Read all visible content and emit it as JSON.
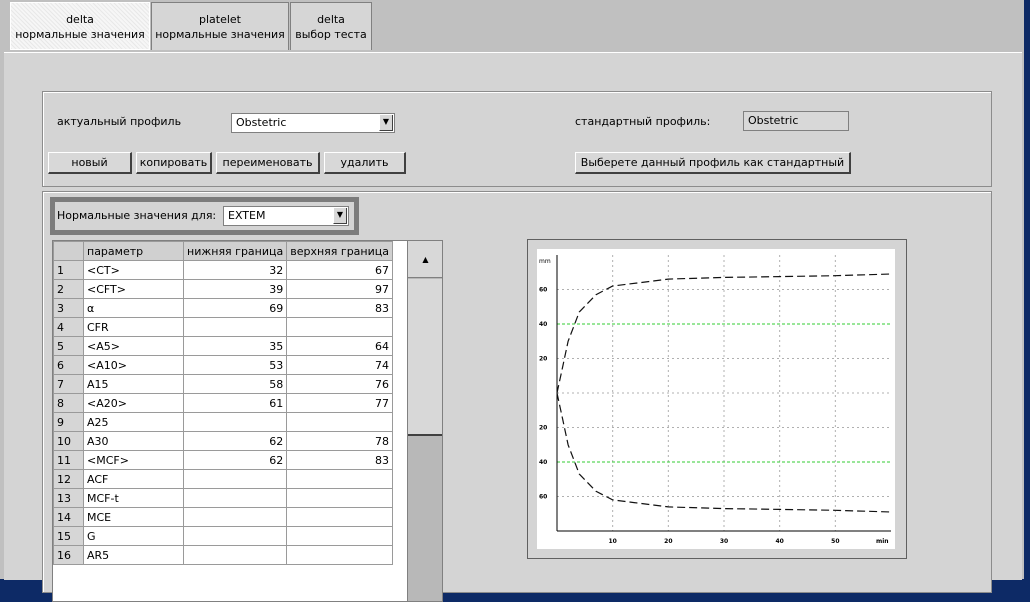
{
  "tabs": [
    {
      "line1": "delta",
      "line2": "нормальные значения"
    },
    {
      "line1": "platelet",
      "line2": "нормальные значения"
    },
    {
      "line1": "delta",
      "line2": "выбор теста"
    }
  ],
  "profile": {
    "actual_label": "актуальный профиль",
    "actual_value": "Obstetric",
    "standard_label": "стандартный профиль:",
    "standard_value": "Obstetric",
    "buttons": {
      "new": "новый",
      "copy": "копировать",
      "rename": "переименовать",
      "delete": "удалить",
      "set_standard": "Выберете данный профиль как стандартный"
    }
  },
  "normal_values": {
    "label": "Нормальные значения для:",
    "selected": "EXTEM"
  },
  "table": {
    "columns": [
      "параметр",
      "нижняя граница",
      "верхняя граница"
    ],
    "rows": [
      {
        "n": "1",
        "param": "<CT>",
        "low": "32",
        "high": "67"
      },
      {
        "n": "2",
        "param": "<CFT>",
        "low": "39",
        "high": "97"
      },
      {
        "n": "3",
        "param": "α",
        "low": "69",
        "high": "83"
      },
      {
        "n": "4",
        "param": "CFR",
        "low": "",
        "high": ""
      },
      {
        "n": "5",
        "param": "<A5>",
        "low": "35",
        "high": "64"
      },
      {
        "n": "6",
        "param": "<A10>",
        "low": "53",
        "high": "74"
      },
      {
        "n": "7",
        "param": "A15",
        "low": "58",
        "high": "76"
      },
      {
        "n": "8",
        "param": "<A20>",
        "low": "61",
        "high": "77"
      },
      {
        "n": "9",
        "param": "A25",
        "low": "",
        "high": ""
      },
      {
        "n": "10",
        "param": "A30",
        "low": "62",
        "high": "78"
      },
      {
        "n": "11",
        "param": "<MCF>",
        "low": "62",
        "high": "83"
      },
      {
        "n": "12",
        "param": "ACF",
        "low": "",
        "high": ""
      },
      {
        "n": "13",
        "param": "MCF-t",
        "low": "",
        "high": ""
      },
      {
        "n": "14",
        "param": "MCE",
        "low": "",
        "high": ""
      },
      {
        "n": "15",
        "param": "G",
        "low": "",
        "high": ""
      },
      {
        "n": "16",
        "param": "AR5",
        "low": "",
        "high": ""
      }
    ]
  },
  "chart_data": {
    "type": "line",
    "ylabel": "mm",
    "xlabel": "min",
    "x_ticks": [
      "10",
      "20",
      "30",
      "40",
      "50"
    ],
    "y_ticks_upper": [
      "60",
      "40",
      "20"
    ],
    "y_ticks_lower": [
      "20",
      "40",
      "60"
    ],
    "xlim": [
      0,
      60
    ],
    "ylim": [
      -80,
      80
    ],
    "grid": true,
    "highlight_lines_mm": [
      40,
      -40
    ],
    "highlight_color": "#33cc33",
    "series": [
      {
        "values": [
          [
            0,
            0
          ],
          [
            1,
            15
          ],
          [
            2,
            30
          ],
          [
            4,
            47
          ],
          [
            7,
            57
          ],
          [
            10,
            62
          ],
          [
            15,
            64
          ],
          [
            20,
            66
          ],
          [
            30,
            67
          ],
          [
            40,
            67.5
          ],
          [
            50,
            68
          ],
          [
            60,
            69
          ]
        ]
      },
      {
        "values": [
          [
            0,
            0
          ],
          [
            1,
            -15
          ],
          [
            2,
            -30
          ],
          [
            4,
            -47
          ],
          [
            7,
            -57
          ],
          [
            10,
            -62
          ],
          [
            15,
            -64
          ],
          [
            20,
            -66
          ],
          [
            30,
            -67
          ],
          [
            40,
            -67.5
          ],
          [
            50,
            -68
          ],
          [
            60,
            -69
          ]
        ]
      }
    ]
  }
}
